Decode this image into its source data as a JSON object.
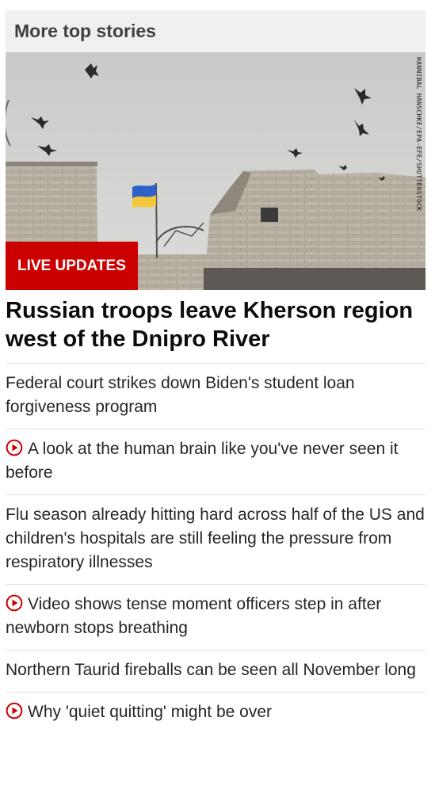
{
  "section": {
    "title": "More top stories"
  },
  "hero": {
    "badge": "LIVE UPDATES",
    "photo_credit": "HANNIBAL HANSCHKE/EPA-EFE/SHUTTERSTOCK",
    "headline": "Russian troops leave Kherson region west of the Dnipro River"
  },
  "stories": [
    {
      "title": "Federal court strikes down Biden's student loan forgiveness program",
      "video": false
    },
    {
      "title": "A look at the human brain like you've never seen it before",
      "video": true
    },
    {
      "title": "Flu season already hitting hard across half of the US and children's hospitals are still feeling the pressure from respiratory illnesses",
      "video": false
    },
    {
      "title": "Video shows tense moment officers step in after newborn stops breathing",
      "video": true
    },
    {
      "title": "Northern Taurid fireballs can be seen all November long",
      "video": false
    },
    {
      "title": "Why 'quiet quitting' might be over",
      "video": true
    }
  ],
  "colors": {
    "accent": "#cc0000",
    "header_bg": "#f0f0f0",
    "text": "#262626"
  },
  "icons": {
    "video_indicator": "play-circle-icon"
  }
}
